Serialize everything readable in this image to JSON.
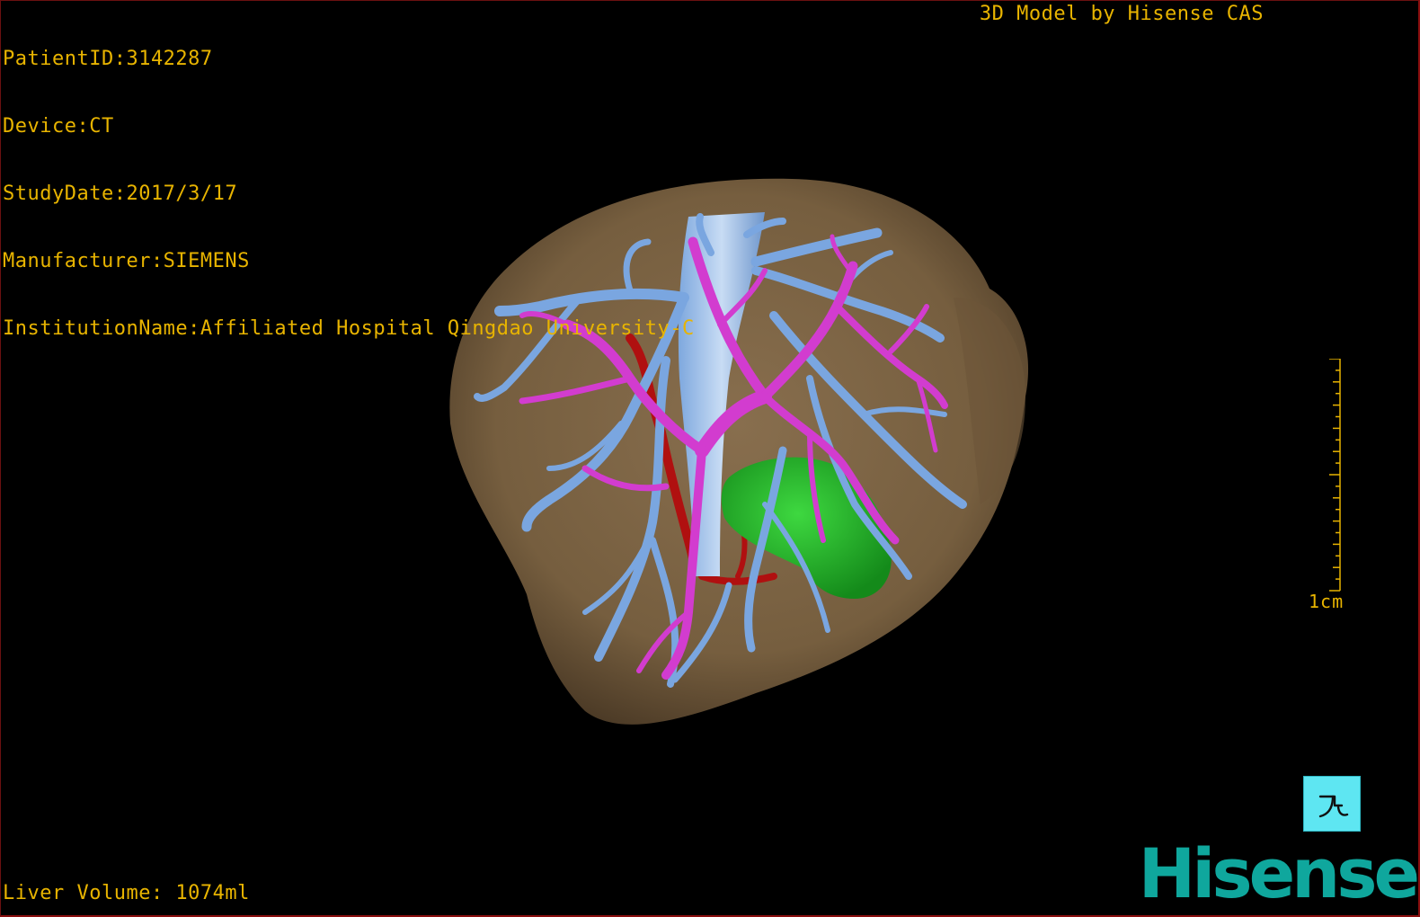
{
  "info": {
    "patient_id": "PatientID:3142287",
    "device": "Device:CT",
    "study_date": "StudyDate:2017/3/17",
    "manufacturer": "Manufacturer:SIEMENS",
    "institution": "InstitutionName:Affiliated Hospital Qingdao University-C"
  },
  "brand_caption": "3D Model by Hisense CAS",
  "liver_volume": "Liver Volume: 1074ml",
  "scale": {
    "label": "1cm"
  },
  "logo": "Hisense",
  "colors": {
    "text": "#e8b400",
    "liver": "#8a6e47",
    "hepatic_vein": "#7aa6e0",
    "portal_vein": "#d23ccf",
    "artery": "#b01010",
    "tumor": "#22b22a",
    "logo": "#0fa79d",
    "orient_button": "#5ee6f2"
  },
  "icons": {
    "orientation": "orientation-cube-icon"
  }
}
